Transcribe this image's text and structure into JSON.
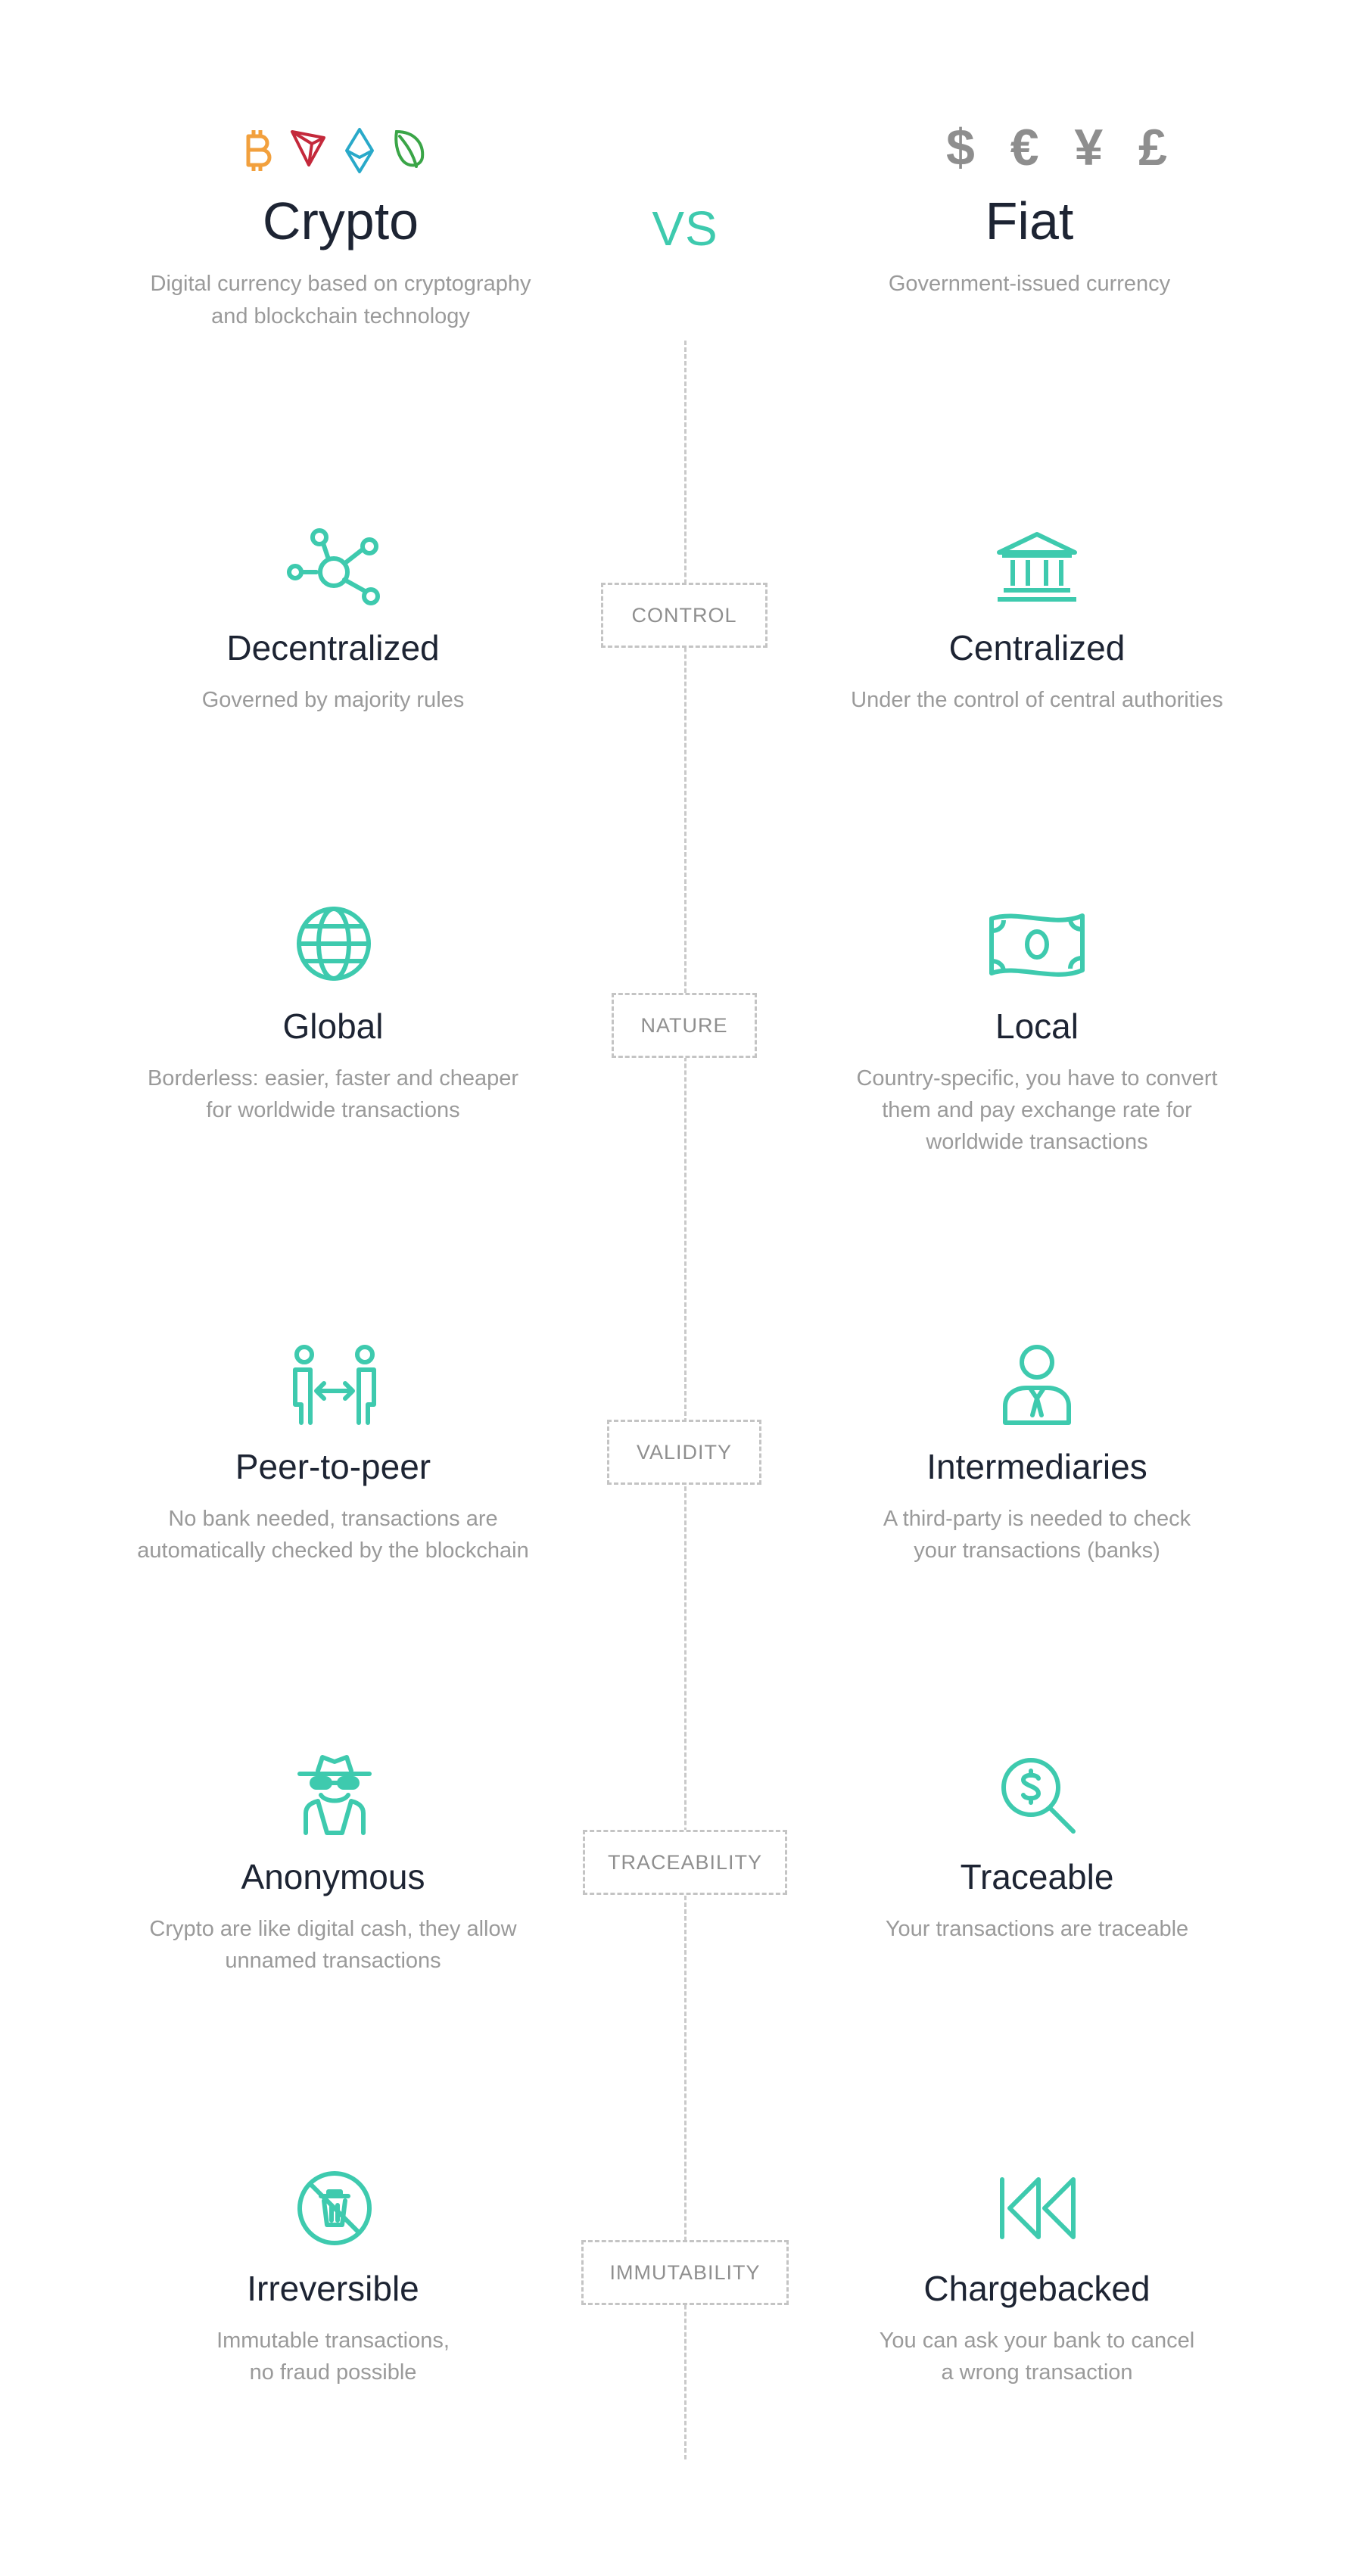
{
  "header": {
    "vs": "VS",
    "crypto": {
      "title": "Crypto",
      "desc1": "Digital currency based on cryptography",
      "desc2": "and blockchain technology",
      "icons": [
        "bitcoin-icon",
        "tron-icon",
        "ethereum-icon",
        "leaf-coin-icon"
      ],
      "icon_colors": [
        "#f2a03d",
        "#c4293b",
        "#29a9c9",
        "#3aa547"
      ]
    },
    "fiat": {
      "title": "Fiat",
      "desc1": "Government-issued currency",
      "symbols": "$ € ¥ £"
    }
  },
  "categories": [
    "CONTROL",
    "NATURE",
    "VALIDITY",
    "TRACEABILITY",
    "IMMUTABILITY"
  ],
  "rows": [
    {
      "left": {
        "title": "Decentralized",
        "desc1": "Governed by majority rules",
        "desc2": "",
        "icon": "network-icon"
      },
      "right": {
        "title": "Centralized",
        "desc1": "Under the control of central authorities",
        "desc2": "",
        "desc3": "",
        "icon": "bank-icon"
      }
    },
    {
      "left": {
        "title": "Global",
        "desc1": "Borderless: easier, faster and cheaper",
        "desc2": "for worldwide transactions",
        "icon": "globe-icon"
      },
      "right": {
        "title": "Local",
        "desc1": "Country-specific, you have to convert",
        "desc2": "them and pay exchange rate for",
        "desc3": "worldwide transactions",
        "icon": "banknote-icon"
      }
    },
    {
      "left": {
        "title": "Peer-to-peer",
        "desc1": "No bank needed, transactions are",
        "desc2": "automatically checked by the blockchain",
        "icon": "peer-exchange-icon"
      },
      "right": {
        "title": "Intermediaries",
        "desc1": "A third-party is needed to check",
        "desc2": "your transactions (banks)",
        "desc3": "",
        "icon": "businessman-icon"
      }
    },
    {
      "left": {
        "title": "Anonymous",
        "desc1": "Crypto are like digital cash, they allow",
        "desc2": "unnamed transactions",
        "icon": "spy-icon"
      },
      "right": {
        "title": "Traceable",
        "desc1": "Your transactions are traceable",
        "desc2": "",
        "desc3": "",
        "icon": "dollar-search-icon"
      }
    },
    {
      "left": {
        "title": "Irreversible",
        "desc1": "Immutable transactions,",
        "desc2": "no fraud possible",
        "icon": "no-delete-icon"
      },
      "right": {
        "title": "Chargebacked",
        "desc1": "You can ask your bank to cancel",
        "desc2": "a wrong transaction",
        "desc3": "",
        "icon": "rewind-icon"
      }
    }
  ],
  "colors": {
    "accent": "#3ecaae",
    "title": "#1d2433",
    "muted": "#9a9a9a",
    "dash": "#c4c4c4"
  }
}
